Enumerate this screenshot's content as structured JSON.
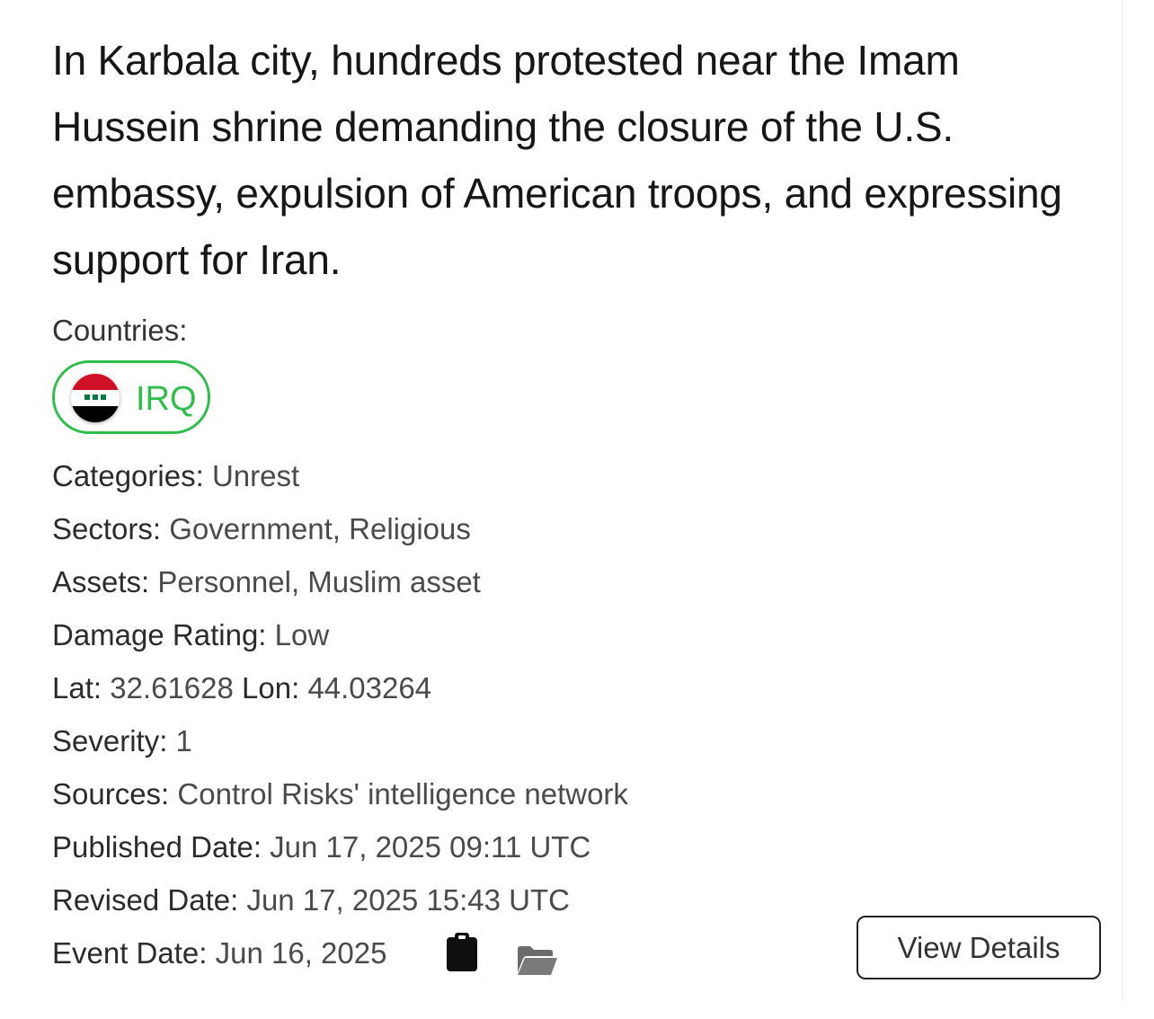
{
  "event": {
    "headline": "In Karbala city, hundreds protested near the Imam Hussein shrine demanding the closure of the U.S. embassy, expulsion of American troops, and expressing support for Iran.",
    "countries_label": "Countries:",
    "country_chip": {
      "code": "IRQ",
      "flag_icon": "iraq-flag-icon",
      "border_color": "#2fbe4a"
    },
    "categories": {
      "label": "Categories:",
      "value": "Unrest"
    },
    "sectors": {
      "label": "Sectors:",
      "value": "Government, Religious"
    },
    "assets": {
      "label": "Assets:",
      "value": "Personnel, Muslim asset"
    },
    "damage_rating": {
      "label": "Damage Rating:",
      "value": "Low"
    },
    "lat": {
      "label": "Lat:",
      "value": "32.61628"
    },
    "lon": {
      "label": "Lon:",
      "value": "44.03264"
    },
    "severity": {
      "label": "Severity:",
      "value": "1"
    },
    "sources": {
      "label": "Sources:",
      "value": "Control Risks' intelligence network"
    },
    "published_date": {
      "label": "Published Date:",
      "value": "Jun 17, 2025 09:11 UTC"
    },
    "revised_date": {
      "label": "Revised Date:",
      "value": "Jun 17, 2025 15:43 UTC"
    },
    "event_date": {
      "label": "Event Date:",
      "value": "Jun 16, 2025"
    },
    "action_icons": [
      "clipboard-icon",
      "folder-open-icon"
    ],
    "view_details_label": "View Details"
  }
}
